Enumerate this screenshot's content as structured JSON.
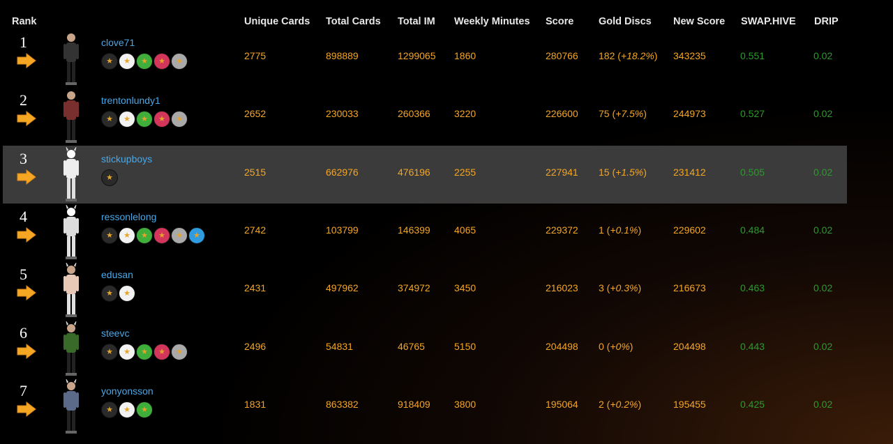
{
  "header": {
    "rank": "Rank",
    "unique_cards": "Unique Cards",
    "total_cards": "Total Cards",
    "total_im": "Total IM",
    "weekly_minutes": "Weekly Minutes",
    "score": "Score",
    "gold_discs": "Gold Discs",
    "new_score": "New Score",
    "swap_hive": "SWAP.HIVE",
    "drip": "DRIP"
  },
  "disc_colors": {
    "black": "#2a2a2a",
    "white": "#f2f2f2",
    "green": "#3fae3a",
    "red": "#d3365a",
    "silver": "#a9a9a9",
    "blue": "#2f9be0"
  },
  "rows": [
    {
      "rank": "1",
      "user": "clove71",
      "discs": [
        "black",
        "white",
        "green",
        "red",
        "silver"
      ],
      "unique": "2775",
      "total": "898889",
      "im": "1299065",
      "weekly": "1860",
      "score": "280766",
      "gold": "182",
      "gold_pct": "+18.2%",
      "new_score": "343235",
      "swap": "0.551",
      "drip": "0.02"
    },
    {
      "rank": "2",
      "user": "trentonlundy1",
      "discs": [
        "black",
        "white",
        "green",
        "red",
        "silver"
      ],
      "unique": "2652",
      "total": "230033",
      "im": "260366",
      "weekly": "3220",
      "score": "226600",
      "gold": "75",
      "gold_pct": "+7.5%",
      "new_score": "244973",
      "swap": "0.527",
      "drip": "0.02"
    },
    {
      "rank": "3",
      "user": "stickupboys",
      "discs": [
        "black"
      ],
      "unique": "2515",
      "total": "662976",
      "im": "476196",
      "weekly": "2255",
      "score": "227941",
      "gold": "15",
      "gold_pct": "+1.5%",
      "new_score": "231412",
      "swap": "0.505",
      "drip": "0.02"
    },
    {
      "rank": "4",
      "user": "ressonlelong",
      "discs": [
        "black",
        "white",
        "green",
        "red",
        "silver",
        "blue"
      ],
      "unique": "2742",
      "total": "103799",
      "im": "146399",
      "weekly": "4065",
      "score": "229372",
      "gold": "1",
      "gold_pct": "+0.1%",
      "new_score": "229602",
      "swap": "0.484",
      "drip": "0.02"
    },
    {
      "rank": "5",
      "user": "edusan",
      "discs": [
        "black",
        "white"
      ],
      "unique": "2431",
      "total": "497962",
      "im": "374972",
      "weekly": "3450",
      "score": "216023",
      "gold": "3",
      "gold_pct": "+0.3%",
      "new_score": "216673",
      "swap": "0.463",
      "drip": "0.02"
    },
    {
      "rank": "6",
      "user": "steevc",
      "discs": [
        "black",
        "white",
        "green",
        "red",
        "silver"
      ],
      "unique": "2496",
      "total": "54831",
      "im": "46765",
      "weekly": "5150",
      "score": "204498",
      "gold": "0",
      "gold_pct": "+0%",
      "new_score": "204498",
      "swap": "0.443",
      "drip": "0.02"
    },
    {
      "rank": "7",
      "user": "yonyonsson",
      "discs": [
        "black",
        "white",
        "green"
      ],
      "unique": "1831",
      "total": "863382",
      "im": "918409",
      "weekly": "3800",
      "score": "195064",
      "gold": "2",
      "gold_pct": "+0.2%",
      "new_score": "195455",
      "swap": "0.425",
      "drip": "0.02"
    }
  ]
}
